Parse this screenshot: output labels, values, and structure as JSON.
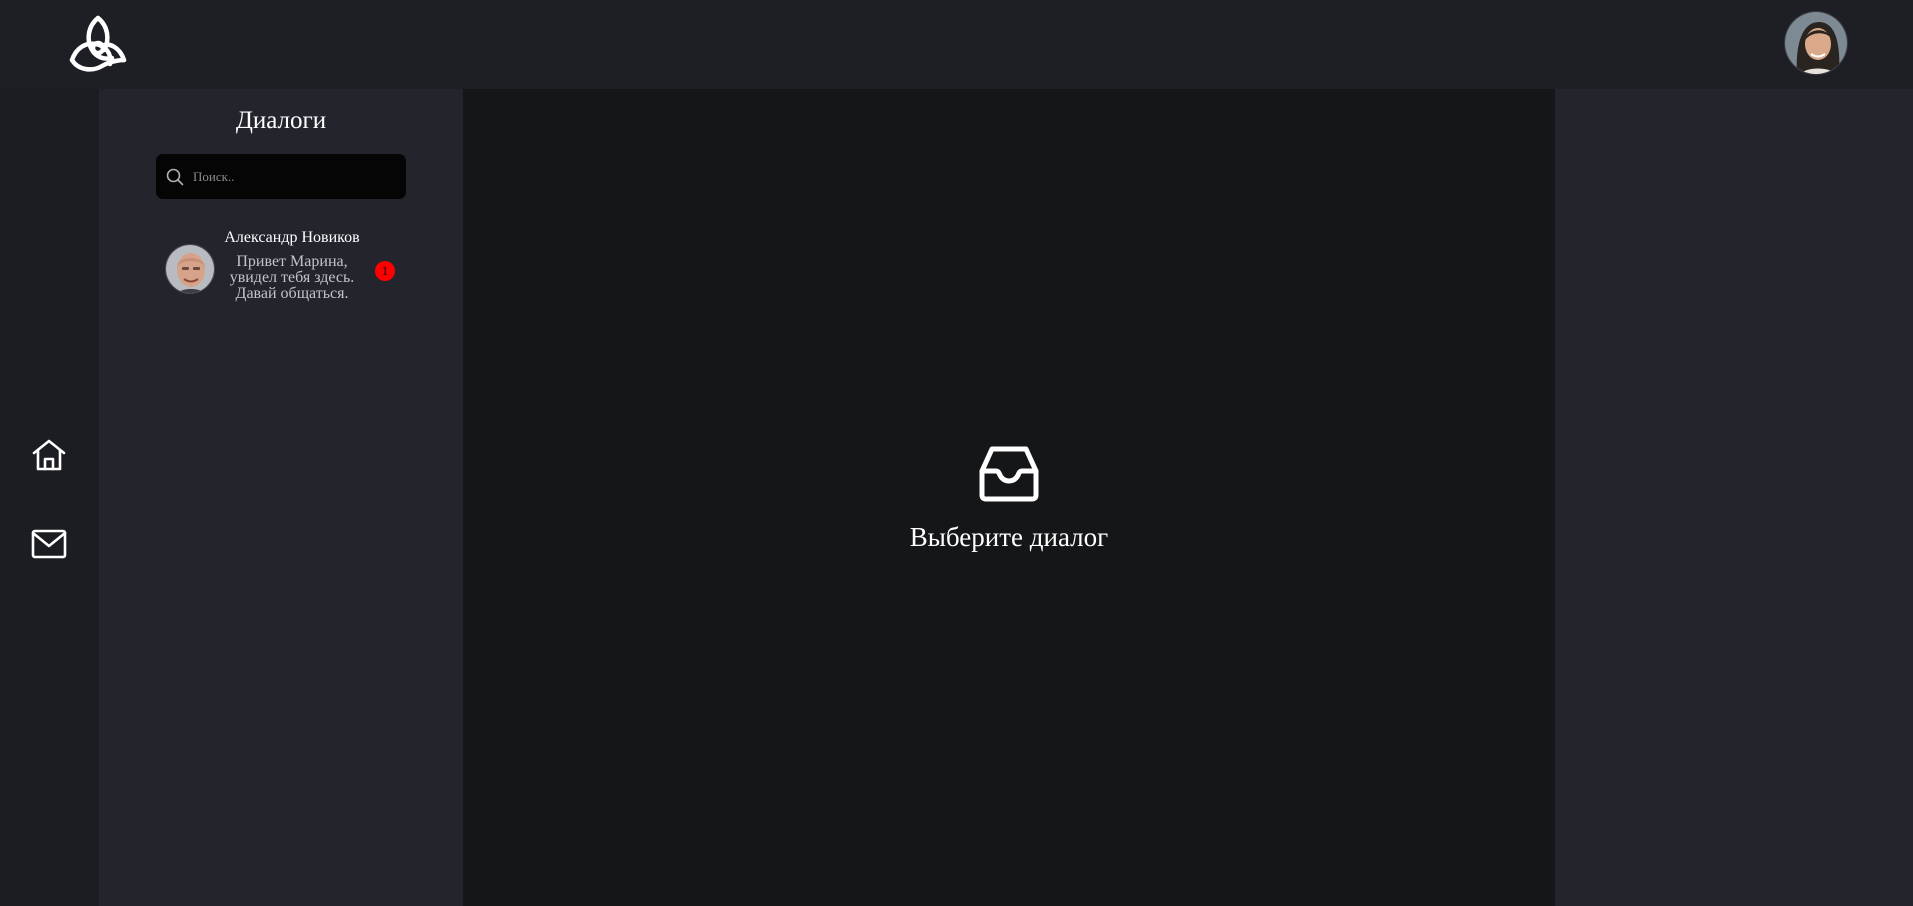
{
  "header": {
    "logo_icon": "triquetra-logo-icon",
    "user_avatar": "user-avatar-photo"
  },
  "nav": {
    "items": [
      {
        "icon": "home-icon"
      },
      {
        "icon": "mail-icon"
      }
    ]
  },
  "dialogs": {
    "title": "Диалоги",
    "search_placeholder": "Поиск..",
    "search_value": "",
    "items": [
      {
        "name": "Александр Новиков",
        "preview": "Привет Марина, увидел тебя здесь. Давай общаться.",
        "unread": "1"
      }
    ]
  },
  "main": {
    "empty_icon": "inbox-icon",
    "empty_text": "Выберите диалог"
  },
  "colors": {
    "topbar": "#1e1f25",
    "panel": "#23242c",
    "main": "#151618",
    "search_bg": "#050505",
    "badge": "#ff0000"
  }
}
